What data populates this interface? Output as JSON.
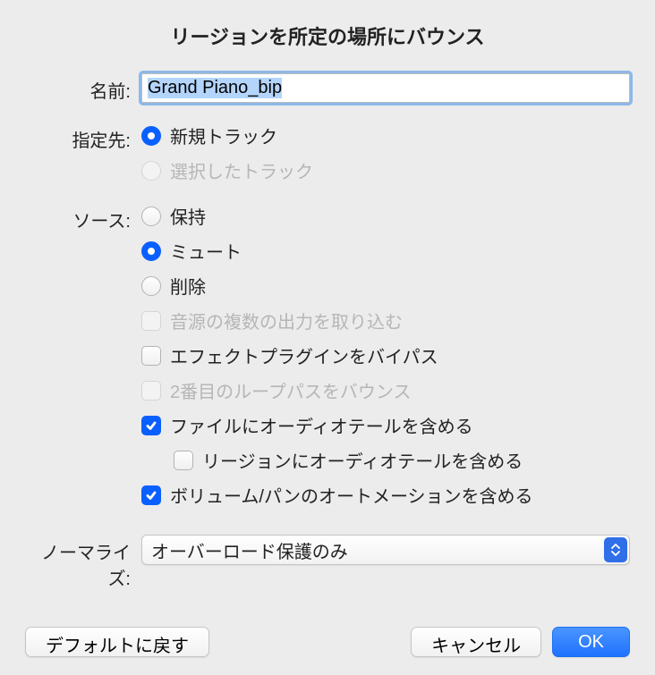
{
  "title": "リージョンを所定の場所にバウンス",
  "name": {
    "label": "名前:",
    "value": "Grand Piano_bip"
  },
  "destination": {
    "label": "指定先:",
    "opts": [
      {
        "label": "新規トラック",
        "selected": true,
        "disabled": false
      },
      {
        "label": "選択したトラック",
        "selected": false,
        "disabled": true
      }
    ]
  },
  "source": {
    "label": "ソース:",
    "radios": [
      {
        "label": "保持",
        "selected": false
      },
      {
        "label": "ミュート",
        "selected": true
      },
      {
        "label": "削除",
        "selected": false
      }
    ],
    "checks": [
      {
        "label": "音源の複数の出力を取り込む",
        "checked": false,
        "disabled": true,
        "indent": false
      },
      {
        "label": "エフェクトプラグインをバイパス",
        "checked": false,
        "disabled": false,
        "indent": false
      },
      {
        "label": "2番目のループパスをバウンス",
        "checked": false,
        "disabled": true,
        "indent": false
      },
      {
        "label": "ファイルにオーディオテールを含める",
        "checked": true,
        "disabled": false,
        "indent": false
      },
      {
        "label": "リージョンにオーディオテールを含める",
        "checked": false,
        "disabled": false,
        "indent": true
      },
      {
        "label": "ボリューム/パンのオートメーションを含める",
        "checked": true,
        "disabled": false,
        "indent": false
      }
    ]
  },
  "normalize": {
    "label": "ノーマライズ:",
    "value": "オーバーロード保護のみ"
  },
  "buttons": {
    "reset": "デフォルトに戻す",
    "cancel": "キャンセル",
    "ok": "OK"
  }
}
